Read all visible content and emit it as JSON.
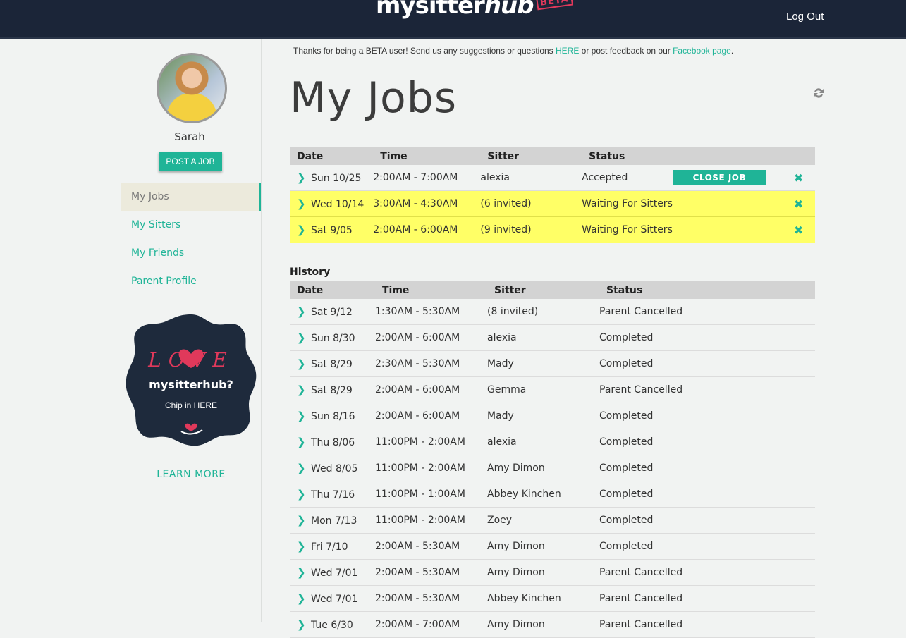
{
  "header": {
    "logo_main": "mysitter",
    "logo_hub": "hub",
    "logo_beta": "BETA",
    "logout_label": "Log Out"
  },
  "sidebar": {
    "username": "Sarah",
    "post_job_label": "POST A JOB",
    "nav": [
      {
        "label": "My Jobs",
        "active": true
      },
      {
        "label": "My Sitters",
        "active": false
      },
      {
        "label": "My Friends",
        "active": false
      },
      {
        "label": "Parent Profile",
        "active": false
      }
    ],
    "badge": {
      "love": "LOVE",
      "brand": "mysitterhub?",
      "cta": "Chip in HERE"
    },
    "learn_more_label": "LEARN MORE"
  },
  "beta_note": {
    "text_before": "Thanks for being a BETA user! Send us any suggestions or questions ",
    "link1": "HERE",
    "text_middle": " or post feedback on our ",
    "link2": "Facebook page",
    "text_after": "."
  },
  "page_title": "My Jobs",
  "columns": [
    "Date",
    "Time",
    "Sitter",
    "Status"
  ],
  "upcoming_jobs": [
    {
      "date": "Sun 10/25",
      "time": "2:00AM - 7:00AM",
      "sitter": "alexia",
      "status": "Accepted",
      "action": "CLOSE JOB",
      "highlight": false
    },
    {
      "date": "Wed 10/14",
      "time": "3:00AM - 4:30AM",
      "sitter": "(6 invited)",
      "status": "Waiting For Sitters",
      "action": "",
      "highlight": true
    },
    {
      "date": "Sat 9/05",
      "time": "2:00AM - 6:00AM",
      "sitter": "(9 invited)",
      "status": "Waiting For Sitters",
      "action": "",
      "highlight": true
    }
  ],
  "history_label": "History",
  "history_jobs": [
    {
      "date": "Sat 9/12",
      "time": "1:30AM - 5:30AM",
      "sitter": "(8 invited)",
      "status": "Parent Cancelled"
    },
    {
      "date": "Sun 8/30",
      "time": "2:00AM - 6:00AM",
      "sitter": "alexia",
      "status": "Completed"
    },
    {
      "date": "Sat 8/29",
      "time": "2:30AM - 5:30AM",
      "sitter": "Mady",
      "status": "Completed"
    },
    {
      "date": "Sat 8/29",
      "time": "2:00AM - 6:00AM",
      "sitter": "Gemma",
      "status": "Parent Cancelled"
    },
    {
      "date": "Sun 8/16",
      "time": "2:00AM - 6:00AM",
      "sitter": "Mady",
      "status": "Completed"
    },
    {
      "date": "Thu 8/06",
      "time": "11:00PM - 2:00AM",
      "sitter": "alexia",
      "status": "Completed"
    },
    {
      "date": "Wed 8/05",
      "time": "11:00PM - 2:00AM",
      "sitter": "Amy Dimon",
      "status": "Completed"
    },
    {
      "date": "Thu 7/16",
      "time": "11:00PM - 1:00AM",
      "sitter": "Abbey Kinchen",
      "status": "Completed"
    },
    {
      "date": "Mon 7/13",
      "time": "11:00PM - 2:00AM",
      "sitter": "Zoey",
      "status": "Completed"
    },
    {
      "date": "Fri 7/10",
      "time": "2:00AM - 5:30AM",
      "sitter": "Amy Dimon",
      "status": "Completed"
    },
    {
      "date": "Wed 7/01",
      "time": "2:00AM - 5:30AM",
      "sitter": "Amy Dimon",
      "status": "Parent Cancelled"
    },
    {
      "date": "Wed 7/01",
      "time": "2:00AM - 5:30AM",
      "sitter": "Abbey Kinchen",
      "status": "Parent Cancelled"
    },
    {
      "date": "Tue 6/30",
      "time": "2:00AM - 7:00AM",
      "sitter": "Amy Dimon",
      "status": "Parent Cancelled"
    }
  ],
  "colors": {
    "accent": "#1fb497",
    "header_bg": "#1b2538",
    "highlight_row": "#ffff66",
    "active_nav_bg": "#eceadc"
  }
}
